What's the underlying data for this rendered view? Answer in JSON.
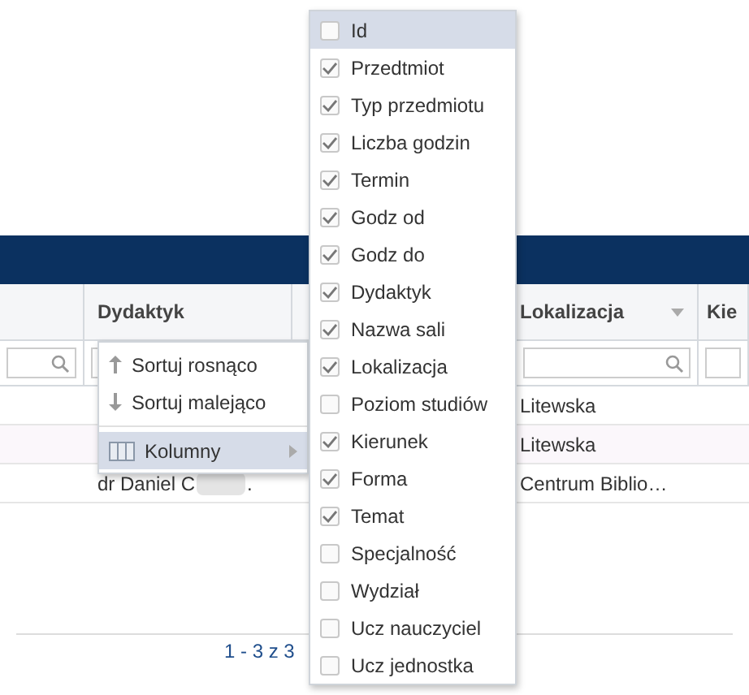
{
  "table": {
    "columns": [
      {},
      {
        "label": "Dydaktyk"
      },
      {},
      {
        "label": "Lokalizacja",
        "dropdown": true
      },
      {
        "label": "Kie"
      }
    ],
    "rows": [
      {
        "cells": [
          "",
          "",
          "",
          "Litewska",
          ""
        ]
      },
      {
        "cells": [
          "",
          "",
          "",
          "Litewska",
          ""
        ]
      },
      {
        "cells": [
          "",
          "dr Daniel C",
          "",
          "Centrum Biblio…",
          ""
        ],
        "redacted_suffix": "."
      }
    ]
  },
  "pagination": "1 - 3 z 3",
  "context_menu": {
    "items": [
      {
        "kind": "sort_asc",
        "label": "Sortuj rosnąco",
        "highlighted": false
      },
      {
        "kind": "sort_desc",
        "label": "Sortuj malejąco",
        "highlighted": false
      },
      {
        "kind": "submenu",
        "label": "Kolumny",
        "highlighted": true
      }
    ]
  },
  "columns_menu": {
    "items": [
      {
        "label": "Id",
        "checked": false,
        "highlighted": true
      },
      {
        "label": "Przedtmiot",
        "checked": true,
        "highlighted": false
      },
      {
        "label": "Typ przedmiotu",
        "checked": true,
        "highlighted": false
      },
      {
        "label": "Liczba godzin",
        "checked": true,
        "highlighted": false
      },
      {
        "label": "Termin",
        "checked": true,
        "highlighted": false
      },
      {
        "label": "Godz od",
        "checked": true,
        "highlighted": false
      },
      {
        "label": "Godz do",
        "checked": true,
        "highlighted": false
      },
      {
        "label": "Dydaktyk",
        "checked": true,
        "highlighted": false
      },
      {
        "label": "Nazwa sali",
        "checked": true,
        "highlighted": false
      },
      {
        "label": "Lokalizacja",
        "checked": true,
        "highlighted": false
      },
      {
        "label": "Poziom studiów",
        "checked": false,
        "highlighted": false
      },
      {
        "label": "Kierunek",
        "checked": true,
        "highlighted": false
      },
      {
        "label": "Forma",
        "checked": true,
        "highlighted": false
      },
      {
        "label": "Temat",
        "checked": true,
        "highlighted": false
      },
      {
        "label": "Specjalność",
        "checked": false,
        "highlighted": false
      },
      {
        "label": "Wydział",
        "checked": false,
        "highlighted": false
      },
      {
        "label": "Ucz nauczyciel",
        "checked": false,
        "highlighted": false
      },
      {
        "label": "Ucz jednostka",
        "checked": false,
        "highlighted": false
      }
    ]
  }
}
